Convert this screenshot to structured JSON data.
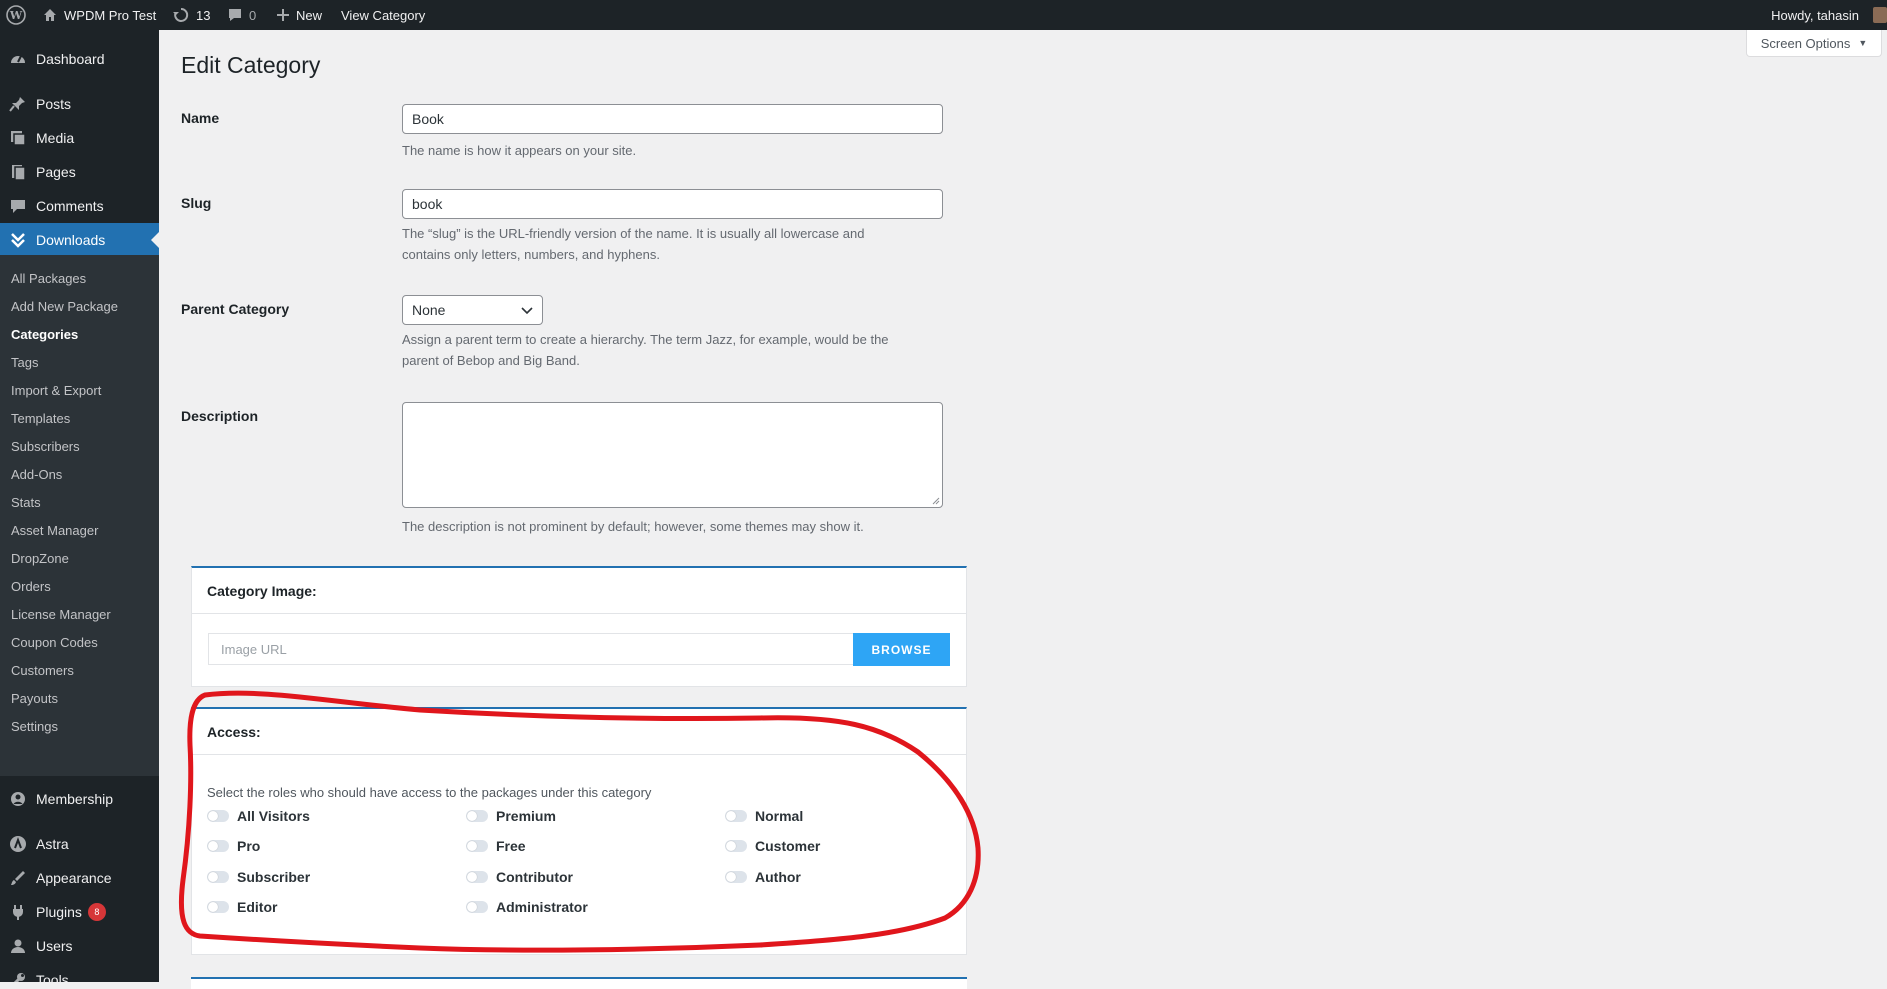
{
  "admin_bar": {
    "site_name": "WPDM Pro Test",
    "updates_count": "13",
    "comments_count": "0",
    "new_label": "New",
    "view_label": "View Category",
    "greeting": "Howdy, tahasin"
  },
  "sidebar": {
    "top_items": [
      {
        "label": "Dashboard",
        "icon": "dashboard-icon"
      },
      {
        "label": "Posts",
        "icon": "pin-icon"
      },
      {
        "label": "Media",
        "icon": "media-icon"
      },
      {
        "label": "Pages",
        "icon": "pages-icon"
      },
      {
        "label": "Comments",
        "icon": "comment-icon"
      },
      {
        "label": "Downloads",
        "icon": "downloads-icon"
      }
    ],
    "downloads_submenu": [
      "All Packages",
      "Add New Package",
      "Categories",
      "Tags",
      "Import & Export",
      "Templates",
      "Subscribers",
      "Add-Ons",
      "Stats",
      "Asset Manager",
      "DropZone",
      "Orders",
      "License Manager",
      "Coupon Codes",
      "Customers",
      "Payouts",
      "Settings"
    ],
    "bottom_items": [
      {
        "label": "Membership",
        "icon": "membership-icon"
      },
      {
        "label": "Astra",
        "icon": "astra-icon"
      },
      {
        "label": "Appearance",
        "icon": "appearance-icon"
      },
      {
        "label": "Plugins",
        "icon": "plugins-icon",
        "badge": "8"
      },
      {
        "label": "Users",
        "icon": "users-icon"
      },
      {
        "label": "Tools",
        "icon": "tools-icon"
      }
    ]
  },
  "page": {
    "title": "Edit Category",
    "screen_options": "Screen Options"
  },
  "form": {
    "name_label": "Name",
    "name_value": "Book",
    "name_desc": "The name is how it appears on your site.",
    "slug_label": "Slug",
    "slug_value": "book",
    "slug_desc_1": "The “slug” is the URL-friendly version of the name. It is usually all lowercase and",
    "slug_desc_2": "contains only letters, numbers, and hyphens.",
    "parent_label": "Parent Category",
    "parent_value": "None",
    "parent_desc_1": "Assign a parent term to create a hierarchy. The term Jazz, for example, would be the",
    "parent_desc_2": "parent of Bebop and Big Band.",
    "description_label": "Description",
    "description_value": "",
    "description_desc": "The description is not prominent by default; however, some themes may show it."
  },
  "category_image": {
    "title": "Category Image:",
    "placeholder": "Image URL",
    "browse_label": "BROWSE"
  },
  "access": {
    "title": "Access:",
    "note": "Select the roles who should have access to the packages under this category",
    "roles": [
      {
        "label": "All Visitors",
        "checked": false
      },
      {
        "label": "Premium",
        "checked": false
      },
      {
        "label": "Normal",
        "checked": false
      },
      {
        "label": "Pro",
        "checked": false
      },
      {
        "label": "Free",
        "checked": false
      },
      {
        "label": "Customer",
        "checked": false
      },
      {
        "label": "Subscriber",
        "checked": false
      },
      {
        "label": "Contributor",
        "checked": false
      },
      {
        "label": "Author",
        "checked": false
      },
      {
        "label": "Editor",
        "checked": false
      },
      {
        "label": "Administrator",
        "checked": false
      }
    ]
  },
  "colors": {
    "admin_dark": "#1d2327",
    "accent_blue": "#2271b1",
    "browse_blue": "#2ea5f5",
    "annotation_red": "#e0161c"
  }
}
